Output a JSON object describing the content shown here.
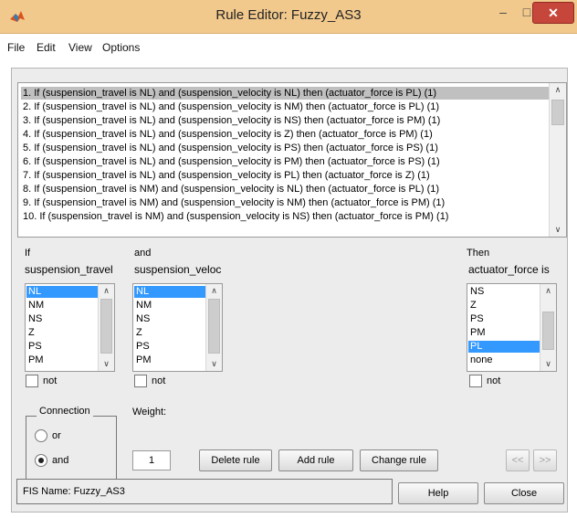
{
  "window": {
    "title": "Rule Editor: Fuzzy_AS3",
    "close_glyph": "✕",
    "min_glyph": "–",
    "max_glyph": "□"
  },
  "menu": {
    "file": "File",
    "edit": "Edit",
    "view": "View",
    "options": "Options"
  },
  "rules": [
    "1. If (suspension_travel is NL) and (suspension_velocity is NL) then (actuator_force is PL) (1)",
    "2. If (suspension_travel is NL) and (suspension_velocity is NM) then (actuator_force is PL) (1)",
    "3. If (suspension_travel is NL) and (suspension_velocity is NS) then (actuator_force is PM) (1)",
    "4. If (suspension_travel is NL) and (suspension_velocity is Z) then (actuator_force is PM) (1)",
    "5. If (suspension_travel is NL) and (suspension_velocity is PS) then (actuator_force is PS) (1)",
    "6. If (suspension_travel is NL) and (suspension_velocity is PM) then (actuator_force is PS) (1)",
    "7. If (suspension_travel is NL) and (suspension_velocity is PL) then (actuator_force is Z) (1)",
    "8. If (suspension_travel is NM) and (suspension_velocity is NL) then (actuator_force is PL) (1)",
    "9. If (suspension_travel is NM) and (suspension_velocity is NM) then (actuator_force is PM) (1)",
    "10. If (suspension_travel is NM) and (suspension_velocity is NS) then (actuator_force is PM) (1)"
  ],
  "if_block": {
    "keyword": "If",
    "variable": "suspension_travel",
    "options": [
      "NL",
      "NM",
      "NS",
      "Z",
      "PS",
      "PM"
    ],
    "selected": "NL",
    "not_label": "not"
  },
  "and_block": {
    "keyword": "and",
    "variable": "suspension_veloc",
    "options": [
      "NL",
      "NM",
      "NS",
      "Z",
      "PS",
      "PM"
    ],
    "selected": "NL",
    "not_label": "not"
  },
  "then_block": {
    "keyword": "Then",
    "variable": "actuator_force is",
    "options": [
      "NS",
      "Z",
      "PS",
      "PM",
      "PL",
      "none"
    ],
    "selected": "PL",
    "not_label": "not"
  },
  "connection": {
    "label": "Connection",
    "or_label": "or",
    "and_label": "and",
    "selected": "and"
  },
  "weight": {
    "label": "Weight:",
    "value": "1"
  },
  "buttons": {
    "delete": "Delete rule",
    "add": "Add rule",
    "change": "Change rule",
    "prev": "<<",
    "next": ">>",
    "help": "Help",
    "close": "Close"
  },
  "status": {
    "fis_name": "FIS Name: Fuzzy_AS3"
  },
  "colors": {
    "selection": "#3399ff",
    "titlebar": "#f2c98d",
    "close_button": "#c7463c"
  }
}
